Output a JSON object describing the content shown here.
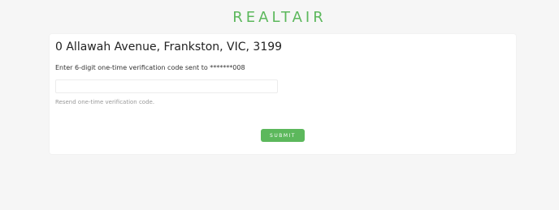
{
  "brand": {
    "logo_text": "REALTAIR",
    "accent_color": "#5cb85c"
  },
  "verification": {
    "address": "0 Allawah Avenue, Frankston, VIC, 3199",
    "instruction": "Enter 6-digit one-time verification code sent to *******008",
    "code_value": "",
    "code_placeholder": "",
    "resend_link": "Resend one-time verification code.",
    "submit_label": "SUBMIT"
  }
}
